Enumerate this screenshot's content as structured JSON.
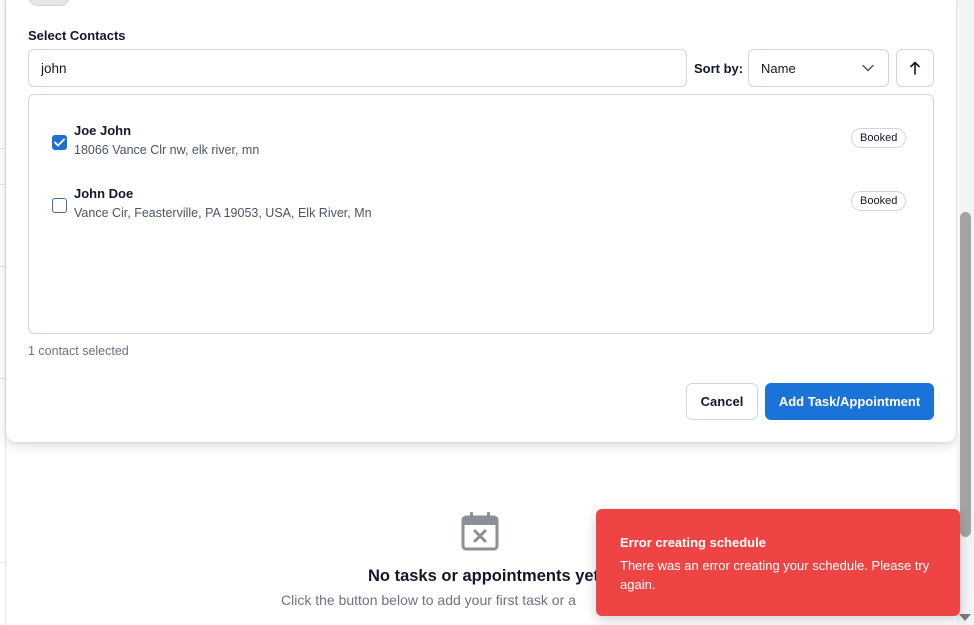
{
  "form": {
    "select_contacts_label": "Select Contacts",
    "search_value": "john",
    "sort_by_label": "Sort by:",
    "sort_selected": "Name",
    "sort_direction": "ascending",
    "contacts": [
      {
        "name": "Joe John",
        "address": "18066 Vance Clr nw, elk river, mn",
        "status": "Booked",
        "checked": true
      },
      {
        "name": "John Doe",
        "address": "Vance Cir, Feasterville, PA 19053, USA, Elk River, Mn",
        "status": "Booked",
        "checked": false
      }
    ],
    "selected_count_text": "1 contact selected",
    "cancel_label": "Cancel",
    "submit_label": "Add Task/Appointment"
  },
  "empty_state": {
    "title": "No tasks or appointments yet",
    "subtitle": "Click the button below to add your first task or a"
  },
  "toast": {
    "title": "Error creating schedule",
    "message": "There was an error creating your schedule. Please try again."
  },
  "colors": {
    "primary": "#1a73d9",
    "error": "#ef4444"
  }
}
